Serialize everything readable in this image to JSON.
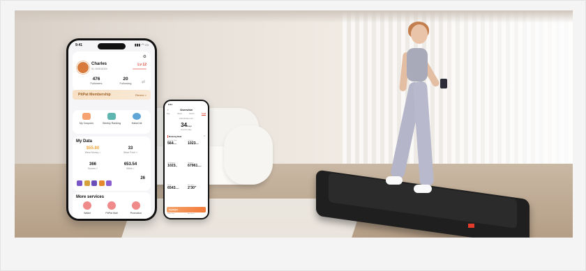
{
  "phone_main": {
    "status_time": "9:41",
    "status_icons": "▮▮▮ ◠ ▭",
    "user": {
      "name": "Charles",
      "id": "ID: 520515320"
    },
    "level": "Lv 12",
    "followers": {
      "value": "476",
      "label": "Followers"
    },
    "following": {
      "value": "20",
      "label": "Following"
    },
    "membership": {
      "title": "PitPat Membership",
      "action": "Renew >"
    },
    "quick_actions": [
      {
        "label": "My Coupons"
      },
      {
        "label": "Weekly Ranking"
      },
      {
        "label": "Hatsel kit"
      }
    ],
    "my_data": {
      "title": "My Data",
      "cells": [
        {
          "value": "$55.80",
          "label": "Wear Money >"
        },
        {
          "value": "33",
          "label": "Wear Point >"
        },
        {
          "value": "366",
          "label": "Scores >"
        },
        {
          "value": "653.54",
          "label": "Miles >"
        }
      ],
      "badge_count": "26"
    },
    "more_services": {
      "title": "More services",
      "items": [
        {
          "label": "Wallet"
        },
        {
          "label": "PitPat Mall"
        },
        {
          "label": "Promotion"
        }
      ]
    }
  },
  "phone_overview": {
    "status_time": "9:41",
    "title": "Overview",
    "tabs": [
      "Day",
      "Week",
      "Month",
      "Total"
    ],
    "date_range": "2023.06 Mar-index",
    "total": {
      "value": "34",
      "unit": "Days",
      "label": "Exercise days"
    },
    "section": "Running Data",
    "stats": [
      {
        "label": "Running Time",
        "value": "564",
        "unit": "mins"
      },
      {
        "label": "Calories",
        "value": "1023",
        "unit": "kcal"
      },
      {
        "label": "Ori Burned",
        "value": "1023",
        "unit": "kg"
      },
      {
        "label": "Distance",
        "value": "67961",
        "unit": "steps"
      },
      {
        "label": "Steps",
        "value": "6543",
        "unit": "times"
      },
      {
        "label": "Best pace",
        "value": "2'30\"",
        "unit": ""
      }
    ],
    "highlight": "Highlight",
    "footer": [
      "Walk 4 km",
      "Best level"
    ]
  },
  "colors": {
    "accent_red": "#e5473a",
    "money_orange": "#f2a33a",
    "membership_brown": "#a1622a",
    "highlight_orange": "#f47b3a"
  }
}
